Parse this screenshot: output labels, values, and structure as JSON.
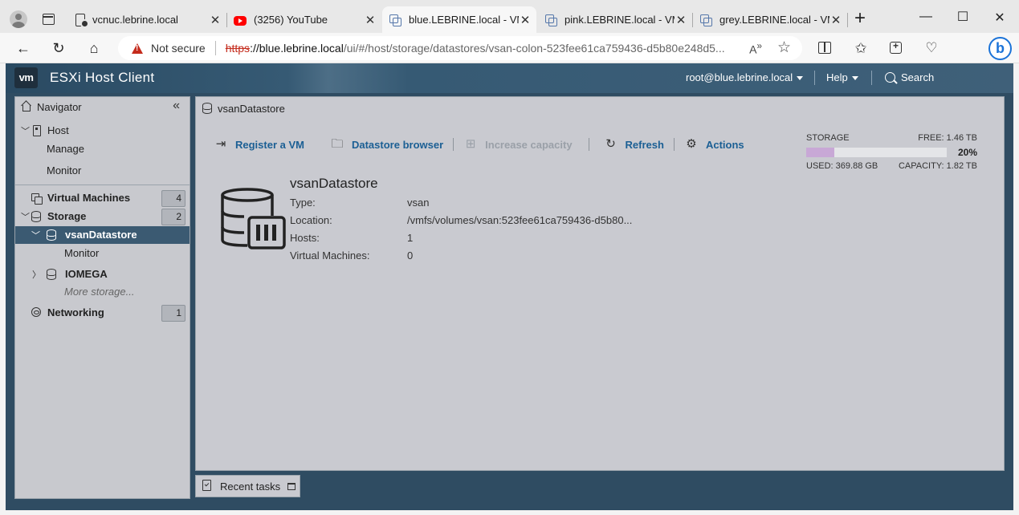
{
  "browser": {
    "tabs": [
      {
        "title": "vcnuc.lebrine.local",
        "icon": "document-icon"
      },
      {
        "title": "(3256) YouTube",
        "icon": "youtube-icon"
      },
      {
        "title": "blue.LEBRINE.local - VM",
        "icon": "vm-icon"
      },
      {
        "title": "pink.LEBRINE.local - VM",
        "icon": "vm-icon"
      },
      {
        "title": "grey.LEBRINE.local - VM",
        "icon": "vm-icon"
      }
    ],
    "active_tab": 2,
    "not_secure": "Not secure",
    "url_scheme": "https",
    "url_host": "://blue.lebrine.local",
    "url_path": "/ui/#/host/storage/datastores/vsan-colon-523fee61ca759436-d5b80e248d5..."
  },
  "app": {
    "logo": "vm",
    "title": "ESXi Host Client",
    "user": "root@blue.lebrine.local",
    "help": "Help",
    "search": "Search"
  },
  "navigator": {
    "title": "Navigator",
    "host": "Host",
    "host_children": [
      "Manage",
      "Monitor"
    ],
    "virtual_machines": {
      "label": "Virtual Machines",
      "count": "4"
    },
    "storage": {
      "label": "Storage",
      "count": "2"
    },
    "datastore_selected": "vsanDatastore",
    "datastore_selected_children": [
      "Monitor"
    ],
    "datastore_other": "IOMEGA",
    "more_storage": "More storage...",
    "networking": {
      "label": "Networking",
      "count": "1"
    }
  },
  "content": {
    "breadcrumb": "vsanDatastore",
    "toolbar": {
      "register_vm": "Register a VM",
      "datastore_browser": "Datastore browser",
      "increase_capacity": "Increase capacity",
      "refresh": "Refresh",
      "actions": "Actions"
    },
    "datastore": {
      "name": "vsanDatastore",
      "fields": [
        {
          "label": "Type:",
          "value": "vsan"
        },
        {
          "label": "Location:",
          "value": "/vmfs/volumes/vsan:523fee61ca759436-d5b80..."
        },
        {
          "label": "Hosts:",
          "value": "1"
        },
        {
          "label": "Virtual Machines:",
          "value": "0"
        }
      ]
    },
    "storage": {
      "label": "STORAGE",
      "free": "FREE: 1.46 TB",
      "percent_text": "20%",
      "used_fraction": 0.2,
      "used": "USED: 369.88 GB",
      "capacity": "CAPACITY: 1.82 TB",
      "bar_color": "#c8a8d6"
    }
  },
  "recent_tasks": {
    "label": "Recent tasks"
  }
}
